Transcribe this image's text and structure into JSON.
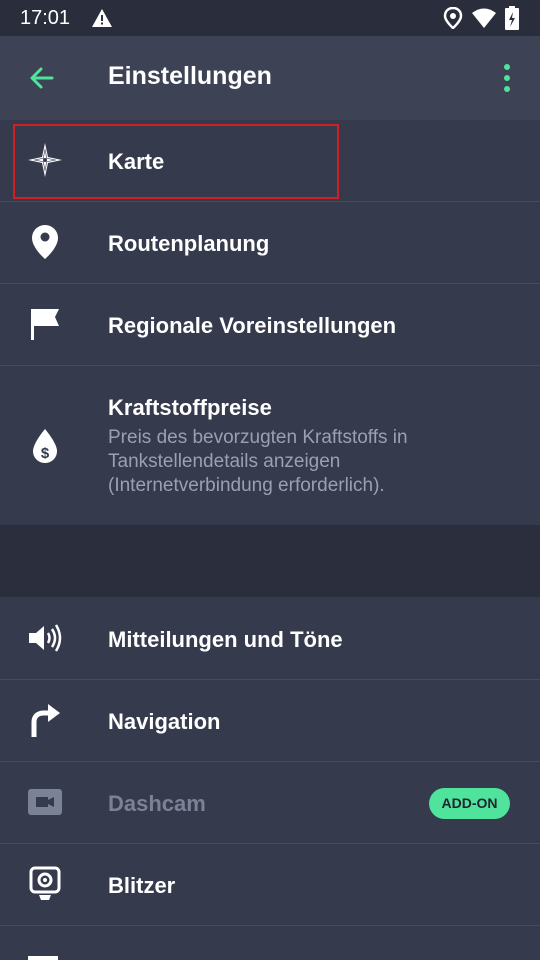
{
  "status_bar": {
    "time": "17:01"
  },
  "app_bar": {
    "title": "Einstellungen"
  },
  "group1": [
    {
      "label": "Karte",
      "icon": "compass-star-icon"
    },
    {
      "label": "Routenplanung",
      "icon": "map-pin-icon"
    },
    {
      "label": "Regionale Voreinstellungen",
      "icon": "flag-icon"
    },
    {
      "label": "Kraftstoffpreise",
      "icon": "fuel-price-icon",
      "description": "Preis des bevorzugten Kraftstoffs in Tankstellendetails anzeigen (Internetverbindung erforderlich)."
    }
  ],
  "group2": [
    {
      "label": "Mitteilungen und Töne",
      "icon": "speaker-icon"
    },
    {
      "label": "Navigation",
      "icon": "turn-right-arrow-icon"
    },
    {
      "label": "Dashcam",
      "icon": "video-camera-icon",
      "badge": "ADD-ON",
      "disabled": true
    },
    {
      "label": "Blitzer",
      "icon": "speed-camera-icon"
    }
  ],
  "colors": {
    "accent": "#4fe39c",
    "background": "#353a4d",
    "app_bar": "#3d4254",
    "highlight": "#d0201f"
  }
}
